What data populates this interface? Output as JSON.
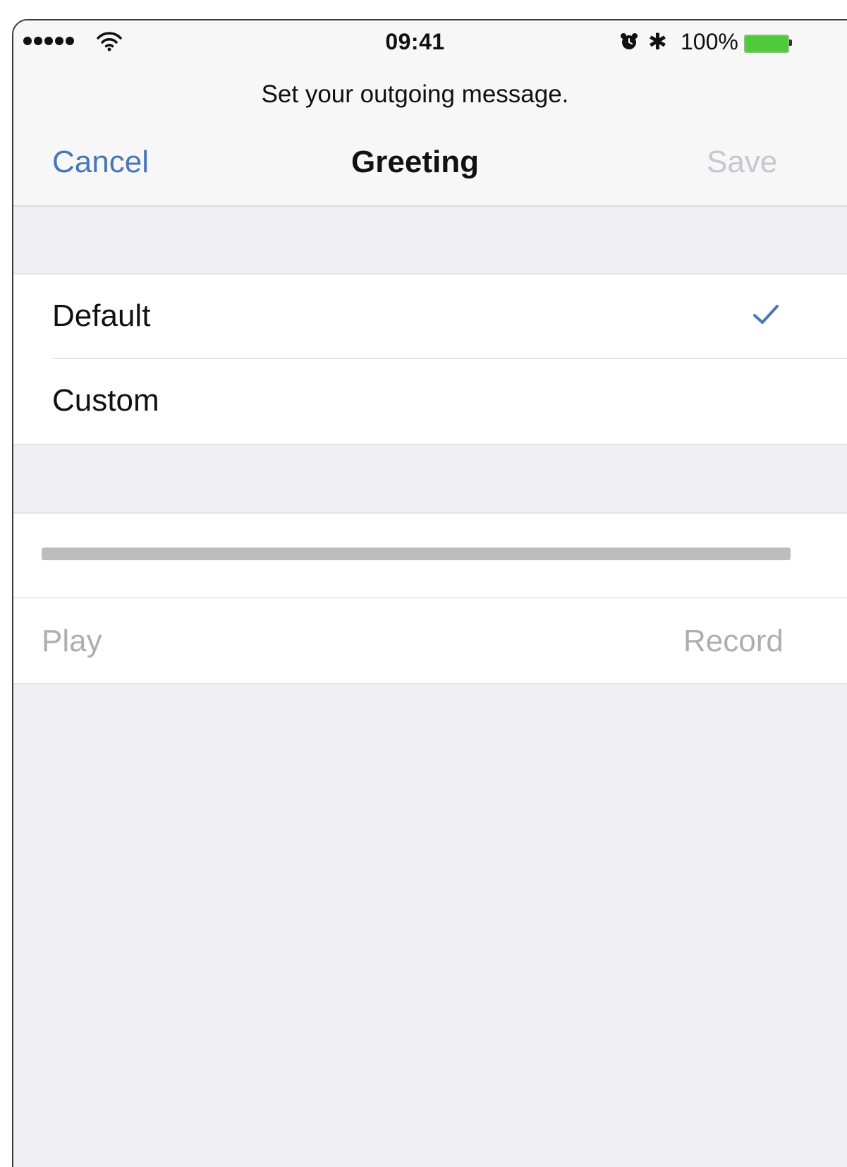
{
  "status_bar": {
    "signal_icon": "signal-dots-icon",
    "wifi_icon": "wifi-icon",
    "time": "09:41",
    "alarm_icon": "alarm-icon",
    "bluetooth_icon": "bluetooth-icon",
    "bluetooth_glyph": "✱",
    "battery_percent": "100%",
    "battery_level": 1.0,
    "battery_color": "#4fca3a"
  },
  "header": {
    "prompt": "Set your outgoing message.",
    "cancel_label": "Cancel",
    "title": "Greeting",
    "save_label": "Save"
  },
  "options": {
    "items": [
      {
        "label": "Default",
        "selected": true
      },
      {
        "label": "Custom",
        "selected": false
      }
    ],
    "checkmark_icon": "checkmark-icon"
  },
  "player": {
    "progress": 0,
    "play_label": "Play",
    "record_label": "Record"
  },
  "colors": {
    "accent": "#4a76b9",
    "disabled": "#c7c7cc",
    "background": "#f0eff4"
  }
}
